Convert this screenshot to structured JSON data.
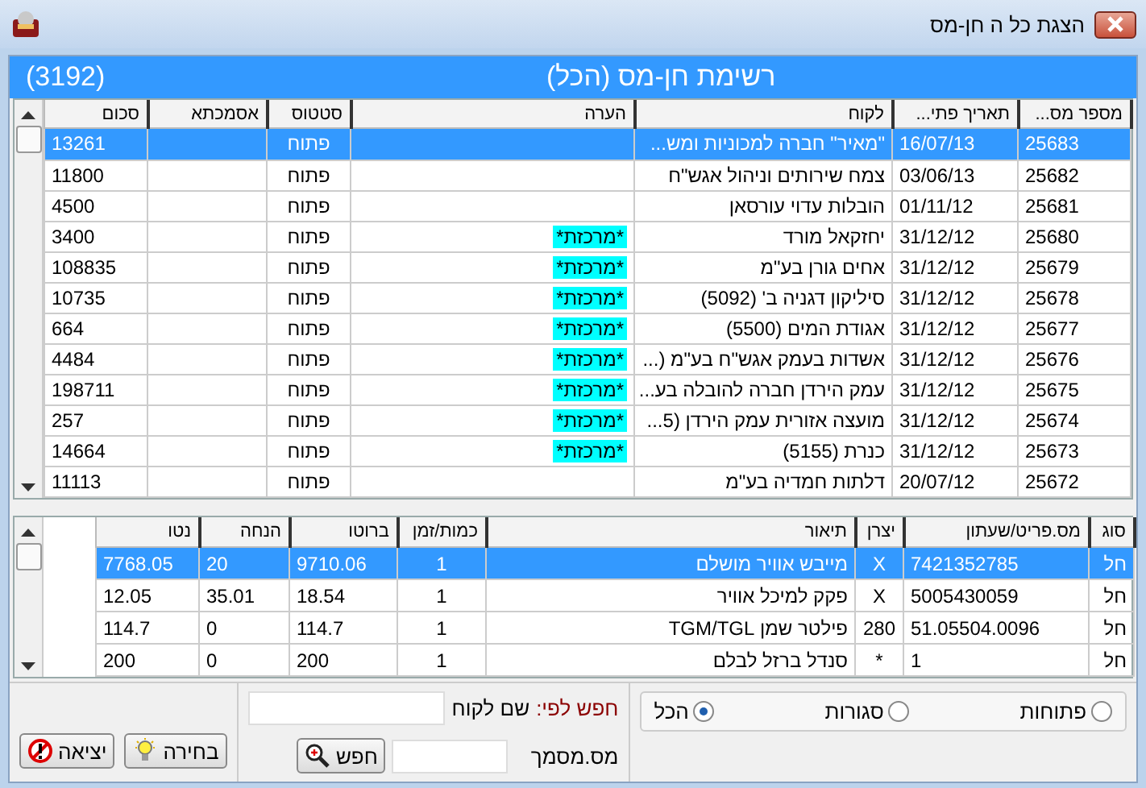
{
  "window": {
    "title": "הצגת כל ה  חן-מס"
  },
  "header": {
    "title": "רשימת חן-מס (הכל)",
    "count": "(3192)"
  },
  "orders": {
    "columns": [
      "מספר מס...",
      "תאריך פתי...",
      "לקוח",
      "הערה",
      "סטטוס",
      "אסמכתא",
      "סכום"
    ],
    "rows": [
      {
        "number": "25683",
        "date": "16/07/13",
        "customer": "\"מאיר\" חברה למכוניות ומש...",
        "status": "פתוח",
        "amount": "13261",
        "selected": true
      },
      {
        "number": "25682",
        "date": "03/06/13",
        "customer": "צמח שירותים  וניהול אגש\"ח",
        "status": "פתוח",
        "amount": "11800",
        "selected": false
      },
      {
        "number": "25681",
        "date": "01/11/12",
        "customer": "הובלות עדוי עורסאן",
        "status": "פתוח",
        "amount": "4500",
        "selected": false
      },
      {
        "number": "25680",
        "date": "31/12/12",
        "customer": "יחזקאל מורד",
        "note": "*מרכזת*",
        "status": "פתוח",
        "amount": "3400",
        "selected": false
      },
      {
        "number": "25679",
        "date": "31/12/12",
        "customer": "אחים גורן בע\"מ",
        "note": "*מרכזת*",
        "status": "פתוח",
        "amount": "108835",
        "selected": false
      },
      {
        "number": "25678",
        "date": "31/12/12",
        "customer": "סיליקון  דגניה ב' (5092)",
        "note": "*מרכזת*",
        "status": "פתוח",
        "amount": "10735",
        "selected": false
      },
      {
        "number": "25677",
        "date": "31/12/12",
        "customer": "אגודת המים (5500)",
        "note": "*מרכזת*",
        "status": "פתוח",
        "amount": "664",
        "selected": false
      },
      {
        "number": "25676",
        "date": "31/12/12",
        "customer": "אשדות בעמק אגש\"ח בע\"מ (...",
        "note": "*מרכזת*",
        "status": "פתוח",
        "amount": "4484",
        "selected": false
      },
      {
        "number": "25675",
        "date": "31/12/12",
        "customer": "עמק הירדן חברה להובלה בע...",
        "note": "*מרכזת*",
        "status": "פתוח",
        "amount": "198711",
        "selected": false
      },
      {
        "number": "25674",
        "date": "31/12/12",
        "customer": "מועצה אזורית עמק הירדן (5...",
        "note": "*מרכזת*",
        "status": "פתוח",
        "amount": "257",
        "selected": false
      },
      {
        "number": "25673",
        "date": "31/12/12",
        "customer": "כנרת (5155)",
        "note": "*מרכזת*",
        "status": "פתוח",
        "amount": "14664",
        "selected": false
      },
      {
        "number": "25672",
        "date": "20/07/12",
        "customer": "דלתות חמדיה בע\"מ",
        "status": "פתוח",
        "amount": "11113",
        "selected": false
      }
    ]
  },
  "lines": {
    "columns": [
      "סוג",
      "מס.פריט/שעתון",
      "יצרן",
      "תיאור",
      "כמות/זמן",
      "ברוטו",
      "הנחה",
      "נטו"
    ],
    "rows": [
      {
        "type": "חל",
        "item": "7421352785",
        "maker": "X",
        "description": "מייבש אוויר מושלם",
        "qty": "1",
        "gross": "9710.06",
        "discount": "20",
        "net": "7768.05",
        "selected": true
      },
      {
        "type": "חל",
        "item": "5005430059",
        "maker": "X",
        "description": "פקק למיכל אוויר",
        "qty": "1",
        "gross": "18.54",
        "discount": "35.01",
        "net": "12.05",
        "selected": false
      },
      {
        "type": "חל",
        "item": "51.05504.0096",
        "maker": "280",
        "description": "פילטר שמן TGM/TGL",
        "qty": "1",
        "gross": "114.7",
        "discount": "0",
        "net": "114.7",
        "selected": false
      },
      {
        "type": "חל",
        "item": "1",
        "maker": "*",
        "description": "סנדל ברזל לבלם",
        "qty": "1",
        "gross": "200",
        "discount": "0",
        "net": "200",
        "selected": false
      }
    ]
  },
  "filter": {
    "options": [
      {
        "label": "פתוחות",
        "selected": false
      },
      {
        "label": "סגורות",
        "selected": false
      },
      {
        "label": "הכל",
        "selected": true
      }
    ]
  },
  "search": {
    "title": "חפש לפי:",
    "customer_label": "שם לקוח",
    "document_label": "מס.מסמך",
    "button": "חפש"
  },
  "buttons": {
    "choose": "בחירה",
    "exit": "יציאה"
  }
}
